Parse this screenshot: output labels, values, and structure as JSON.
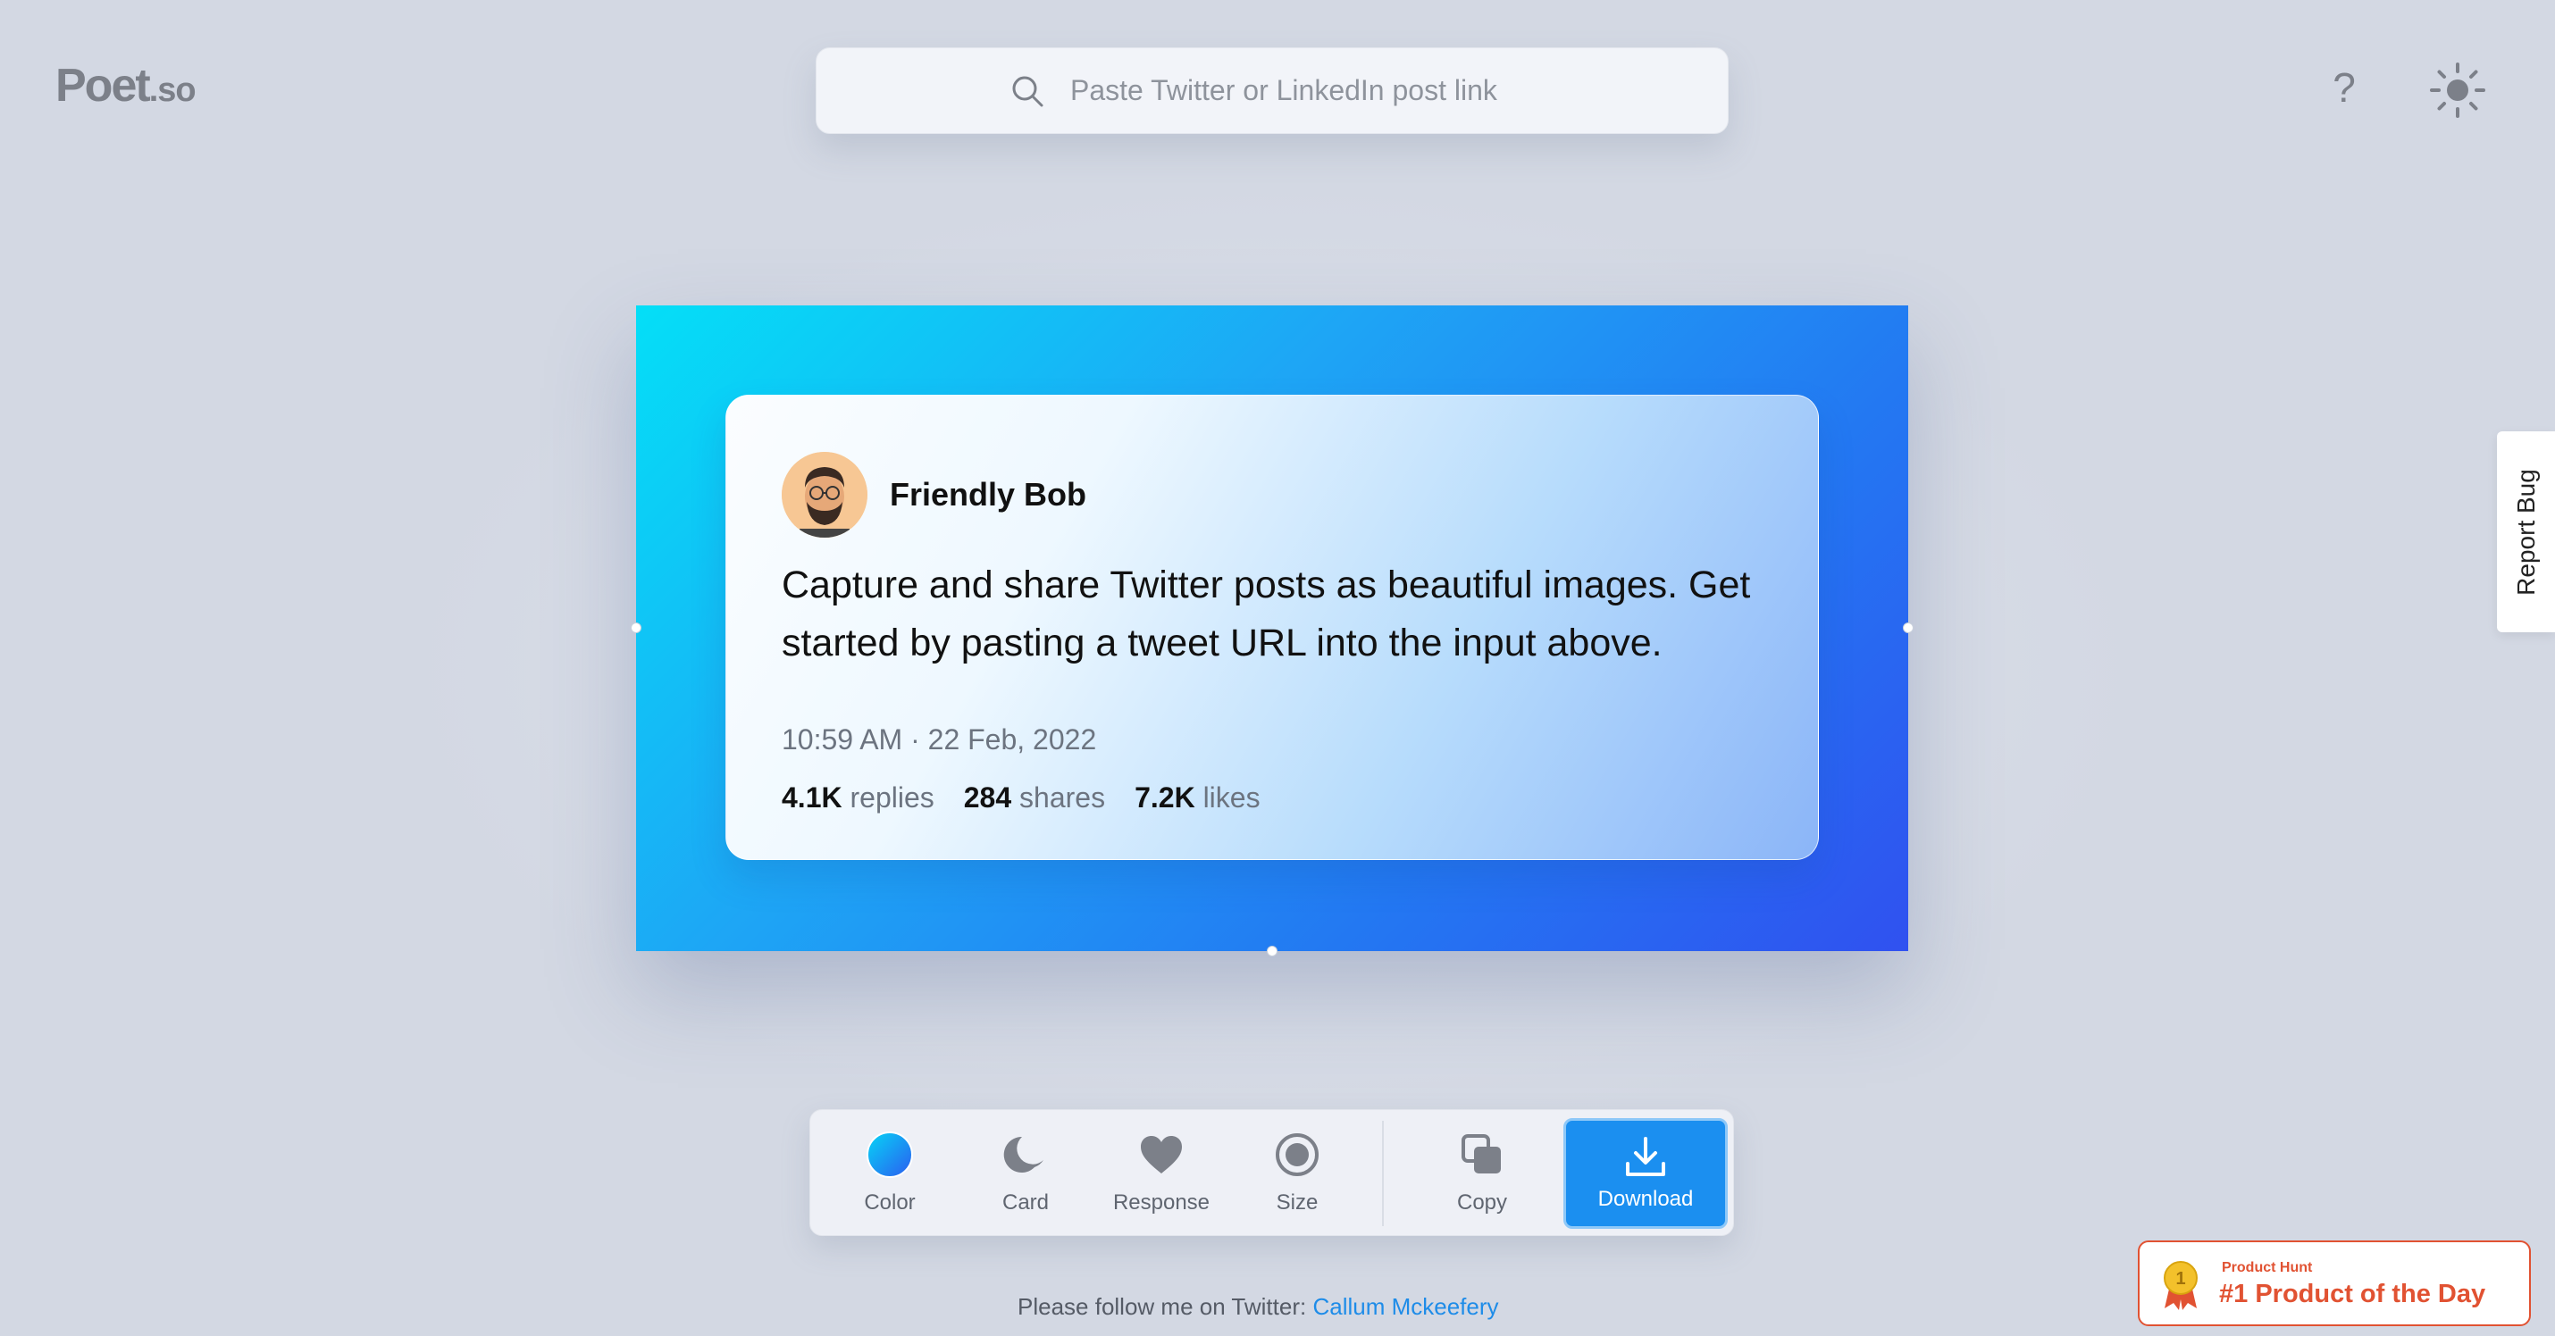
{
  "logo": {
    "name": "Poet",
    "suffix": ".so"
  },
  "search": {
    "placeholder": "Paste Twitter or LinkedIn post link",
    "icon": "search-icon"
  },
  "header": {
    "help_label": "?",
    "theme_icon": "sun-icon"
  },
  "preview": {
    "gradient": [
      "#04dff7",
      "#1ea5f5",
      "#2378f2",
      "#3051f0"
    ],
    "tweet": {
      "author": "Friendly Bob",
      "text": "Capture and share Twitter posts as beautiful images. Get started by pasting a tweet URL into the input above.",
      "timestamp": "10:59 AM · 22 Feb, 2022",
      "replies_count": "4.1K",
      "replies_label": "replies",
      "shares_count": "284",
      "shares_label": "shares",
      "likes_count": "7.2K",
      "likes_label": "likes"
    }
  },
  "toolbar": {
    "color_label": "Color",
    "card_label": "Card",
    "response_label": "Response",
    "size_label": "Size",
    "copy_label": "Copy",
    "download_label": "Download",
    "accent": "#1b8ff0"
  },
  "footer": {
    "text": "Please follow me on Twitter: ",
    "link_text": "Callum Mckeefery"
  },
  "report_bug": {
    "label": "Report Bug"
  },
  "product_hunt": {
    "small": "Product Hunt",
    "big": "#1 Product of the Day",
    "color": "#e15232"
  }
}
